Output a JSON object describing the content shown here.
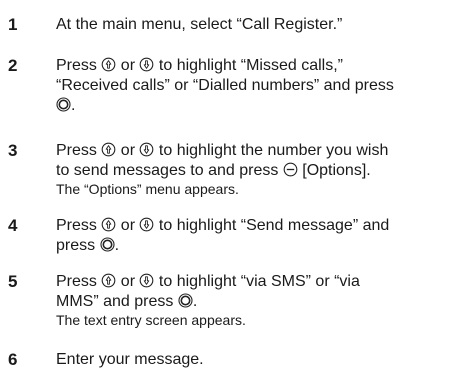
{
  "steps": [
    {
      "number": "1",
      "segments": [
        {
          "text": "At the main menu, select “Call Register.”"
        }
      ]
    },
    {
      "number": "2",
      "segments": [
        {
          "text": "Press "
        },
        {
          "icon": "nav-up-icon"
        },
        {
          "text": " or "
        },
        {
          "icon": "nav-down-icon"
        },
        {
          "text": " to highlight “Missed calls,”"
        },
        {
          "br": true
        },
        {
          "text": "“Received calls” or “Dialled numbers” and press"
        },
        {
          "br": true
        },
        {
          "icon": "center-key-icon"
        },
        {
          "text": "."
        }
      ]
    },
    {
      "number": "3",
      "segments": [
        {
          "text": "Press "
        },
        {
          "icon": "nav-up-icon"
        },
        {
          "text": " or "
        },
        {
          "icon": "nav-down-icon"
        },
        {
          "text": " to highlight the number you wish"
        },
        {
          "br": true
        },
        {
          "text": "to send messages to and press "
        },
        {
          "icon": "soft-key-icon"
        },
        {
          "text": " [Options]."
        }
      ],
      "note": "The “Options” menu appears."
    },
    {
      "number": "4",
      "segments": [
        {
          "text": "Press "
        },
        {
          "icon": "nav-up-icon"
        },
        {
          "text": " or "
        },
        {
          "icon": "nav-down-icon"
        },
        {
          "text": " to highlight “Send message” and"
        },
        {
          "br": true
        },
        {
          "text": "press "
        },
        {
          "icon": "center-key-icon"
        },
        {
          "text": "."
        }
      ]
    },
    {
      "number": "5",
      "segments": [
        {
          "text": "Press "
        },
        {
          "icon": "nav-up-icon"
        },
        {
          "text": " or "
        },
        {
          "icon": "nav-down-icon"
        },
        {
          "text": " to highlight “via SMS” or “via"
        },
        {
          "br": true
        },
        {
          "text": "MMS” and press "
        },
        {
          "icon": "center-key-icon"
        },
        {
          "text": "."
        }
      ],
      "note": "The text entry screen appears."
    },
    {
      "number": "6",
      "segments": [
        {
          "text": "Enter your message."
        }
      ]
    }
  ]
}
